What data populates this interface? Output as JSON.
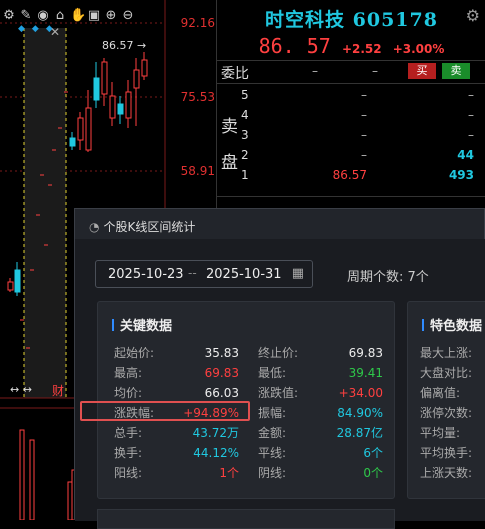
{
  "chart": {
    "price_labels": [
      "92.16",
      "75.53",
      "58.91"
    ],
    "last_price_marker": "86.57",
    "day_label": "财",
    "toolbar_icons": [
      "gear-icon",
      "pen-icon",
      "eye-icon",
      "lock-icon",
      "hand-icon",
      "square-lock-icon",
      "plus-icon",
      "minus-icon"
    ]
  },
  "quote": {
    "name": "时空科技 605178",
    "price": "86. 57",
    "change": "+2.52",
    "change_pct": "+3.00%",
    "wei_label": "委比",
    "wei_values": [
      "–",
      "–"
    ],
    "buy_label": "买",
    "sell_label": "卖",
    "side_chars": [
      "卖",
      "盘"
    ],
    "levels": [
      {
        "lvl": "5",
        "price": "–",
        "vol": ""
      },
      {
        "lvl": "4",
        "price": "–",
        "vol": ""
      },
      {
        "lvl": "3",
        "price": "–",
        "vol": ""
      },
      {
        "lvl": "2",
        "price": "–",
        "vol": "44"
      },
      {
        "lvl": "1",
        "price": "86.57",
        "vol": "493"
      }
    ],
    "colors": {
      "accent": "#20c8e0",
      "up": "#ff4040",
      "down": "#2ec84a"
    }
  },
  "popup": {
    "title": "个股K线区间统计",
    "start_date": "2025-10-23",
    "date_sep": "--",
    "end_date": "2025-10-31",
    "period_label": "周期个数: 7个",
    "card1_title": "关键数据",
    "card2_title": "特色数据",
    "left_stats": [
      {
        "k": "起始价:",
        "v": "35.83",
        "c": "white"
      },
      {
        "k": "最高:",
        "v": "69.83",
        "c": "red"
      },
      {
        "k": "均价:",
        "v": "66.03",
        "c": "white"
      },
      {
        "k": "涨跌幅:",
        "v": "+94.89%",
        "c": "red"
      },
      {
        "k": "总手:",
        "v": "43.72万",
        "c": "cyan"
      },
      {
        "k": "换手:",
        "v": "44.12%",
        "c": "cyan"
      },
      {
        "k": "阳线:",
        "v": "1个",
        "c": "red"
      }
    ],
    "right_stats": [
      {
        "k": "终止价:",
        "v": "69.83",
        "c": "white"
      },
      {
        "k": "最低:",
        "v": "39.41",
        "c": "green"
      },
      {
        "k": "涨跌值:",
        "v": "+34.00",
        "c": "red"
      },
      {
        "k": "振幅:",
        "v": "84.90%",
        "c": "cyan"
      },
      {
        "k": "金额:",
        "v": "28.87亿",
        "c": "cyan"
      },
      {
        "k": "平线:",
        "v": "6个",
        "c": "cyan"
      },
      {
        "k": "阴线:",
        "v": "0个",
        "c": "green"
      }
    ],
    "feature_stats": [
      "最大上涨:",
      "大盘对比:",
      "偏离值:",
      "涨停次数:",
      "平均量:",
      "平均换手:",
      "上涨天数:"
    ]
  }
}
